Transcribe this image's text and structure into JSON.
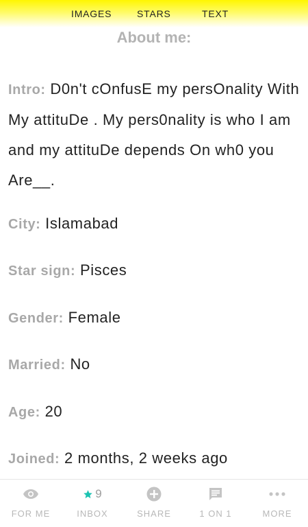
{
  "top_tabs": {
    "images": "IMAGES",
    "stars": "STARS",
    "text": "TEXT"
  },
  "section": {
    "title": "About me:"
  },
  "profile": {
    "intro_label": "Intro:",
    "intro_value": "D0n't cOnfusE my persOnality With My attituDe . My pers0nality is who I am and my attituDe depends On wh0 you Are__.",
    "city_label": "City:",
    "city_value": "Islamabad",
    "star_sign_label": "Star sign:",
    "star_sign_value": "Pisces",
    "gender_label": "Gender:",
    "gender_value": "Female",
    "married_label": "Married:",
    "married_value": "No",
    "age_label": "Age:",
    "age_value": "20",
    "joined_label": "Joined:",
    "joined_value": "2 months, 2 weeks ago"
  },
  "bottom_nav": {
    "for_me": "FOR ME",
    "inbox": "INBOX",
    "inbox_count": "9",
    "share": "SHARE",
    "one_on_one": "1 ON 1",
    "more": "MORE"
  },
  "colors": {
    "top_gradient": "#fff600",
    "label_gray": "#a8a8a8",
    "inbox_star": "#1cc3b2"
  },
  "icons": {
    "for_me": "eye-icon",
    "inbox": "star-icon",
    "share": "plus-circle-icon",
    "one_on_one": "chat-bubble-icon",
    "more": "more-dots-icon"
  }
}
